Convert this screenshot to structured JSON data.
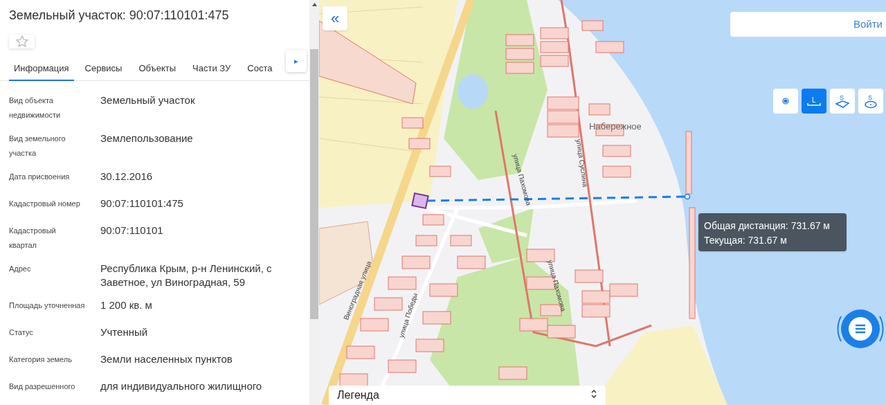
{
  "panel": {
    "title": "Земельный участок: 90:07:110101:475",
    "favorite": false,
    "tabs": [
      {
        "label": "Информация",
        "selected": true
      },
      {
        "label": "Сервисы",
        "selected": false
      },
      {
        "label": "Объекты",
        "selected": false
      },
      {
        "label": "Части ЗУ",
        "selected": false
      },
      {
        "label": "Соста",
        "selected": false
      }
    ],
    "tabs_more": "▸",
    "properties": [
      {
        "label": "Вид объекта недвижимости",
        "value": "Земельный участок"
      },
      {
        "label": "Вид земельного участка",
        "value": "Землепользование"
      },
      {
        "label": "Дата присвоения",
        "value": "30.12.2016"
      },
      {
        "label": "Кадастровый номер",
        "value": "90:07:110101:475"
      },
      {
        "label": "Кадастровый квартал",
        "value": "90:07:110101"
      },
      {
        "label": "Адрес",
        "value": "Республика Крым, р-н Ленинский, с Заветное, ул Виноградная, 59"
      },
      {
        "label": "Площадь уточненная",
        "value": "1 200 кв. м"
      },
      {
        "label": "Статус",
        "value": "Учтенный"
      },
      {
        "label": "Категория земель",
        "value": "Земли населенных пунктов"
      },
      {
        "label": "Вид разрешенного",
        "value": "для индивидуального жилищного"
      }
    ]
  },
  "map": {
    "collapse": "«",
    "login": "Войти",
    "tools": [
      {
        "kind": "point",
        "selected": false
      },
      {
        "kind": "line",
        "symbol": "L",
        "selected": true
      },
      {
        "kind": "area",
        "symbol": "S",
        "selected": false
      },
      {
        "kind": "circle",
        "symbol": "S",
        "selected": false
      }
    ],
    "labels": [
      {
        "text": "Набережное",
        "kind": "place"
      },
      {
        "text": "Виноградная улица",
        "kind": "street"
      },
      {
        "text": "улица Победы",
        "kind": "street"
      },
      {
        "text": "улица Пахомова",
        "kind": "street"
      },
      {
        "text": "улица Суслина",
        "kind": "street"
      },
      {
        "text": "улица Пахомова",
        "kind": "street"
      }
    ],
    "tooltip": [
      "Общая дистанция: 731.67 м",
      "Текущая: 731.67 м"
    ],
    "legend": "Легенда"
  }
}
